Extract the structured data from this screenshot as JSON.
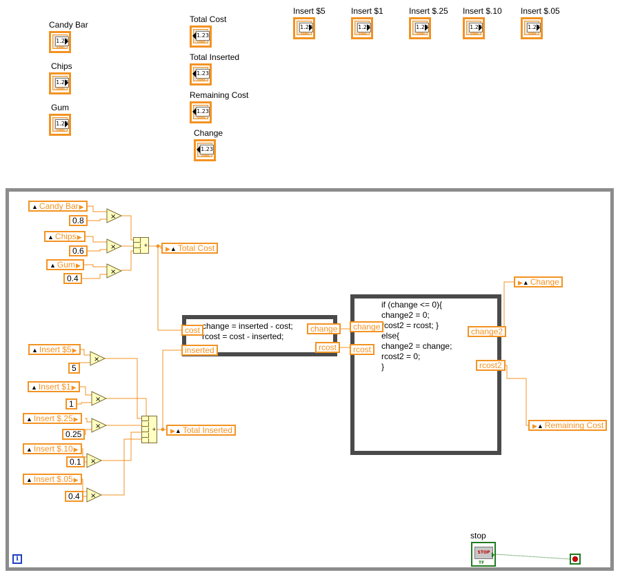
{
  "front_panel": {
    "controls": [
      {
        "label": "Candy Bar",
        "num": "1.23",
        "rep": "DBL"
      },
      {
        "label": "Chips",
        "num": "1.23",
        "rep": "DBL"
      },
      {
        "label": "Gum",
        "num": "1.23",
        "rep": "DBL"
      },
      {
        "label": "Insert $5",
        "num": "1.23",
        "rep": "DBL"
      },
      {
        "label": "Insert $1",
        "num": "1.23",
        "rep": "DBL"
      },
      {
        "label": "Insert $.25",
        "num": "1.23",
        "rep": "DBL"
      },
      {
        "label": "Insert $.10",
        "num": "1.23",
        "rep": "DBL"
      },
      {
        "label": "Insert $.05",
        "num": "1.23",
        "rep": "DBL"
      }
    ],
    "indicators": [
      {
        "label": "Total Cost",
        "num": "1.23",
        "rep": "DBL"
      },
      {
        "label": "Total Inserted",
        "num": "1.23",
        "rep": "DBL"
      },
      {
        "label": "Remaining Cost",
        "num": "1.23",
        "rep": "DBL"
      },
      {
        "label": "Change",
        "num": "1.23",
        "rep": "DBL"
      }
    ]
  },
  "diagram": {
    "price_terms": [
      "Candy Bar",
      "Chips",
      "Gum"
    ],
    "price_consts": [
      "0.8",
      "0.6",
      "0.4"
    ],
    "insert_terms": [
      "Insert $5",
      "Insert $1",
      "Insert $.25",
      "Insert $.10",
      "Insert $.05"
    ],
    "insert_consts": [
      "5",
      "1",
      "0.25",
      "0.1",
      "0.4"
    ],
    "total_cost": "Total Cost",
    "total_inserted": "Total Inserted",
    "change_out": "Change",
    "remaining_out": "Remaining Cost",
    "formula1": {
      "code": "change = inserted - cost;\nrcost = cost - inserted;",
      "in_cost": "cost",
      "in_inserted": "inserted",
      "out_change": "change",
      "out_rcost": "rcost"
    },
    "formula2": {
      "code": "if (change <= 0){\nchange2 = 0;\nrcost2 = rcost; }\nelse{\nchange2 = change;\nrcost2 = 0;\n}",
      "in_change": "change",
      "in_rcost": "rcost",
      "out_change2": "change2",
      "out_rcost2": "rcost2"
    },
    "stop_label": "stop",
    "stop_face": "STOP",
    "stop_tf": "TF",
    "loop_info": "i"
  }
}
